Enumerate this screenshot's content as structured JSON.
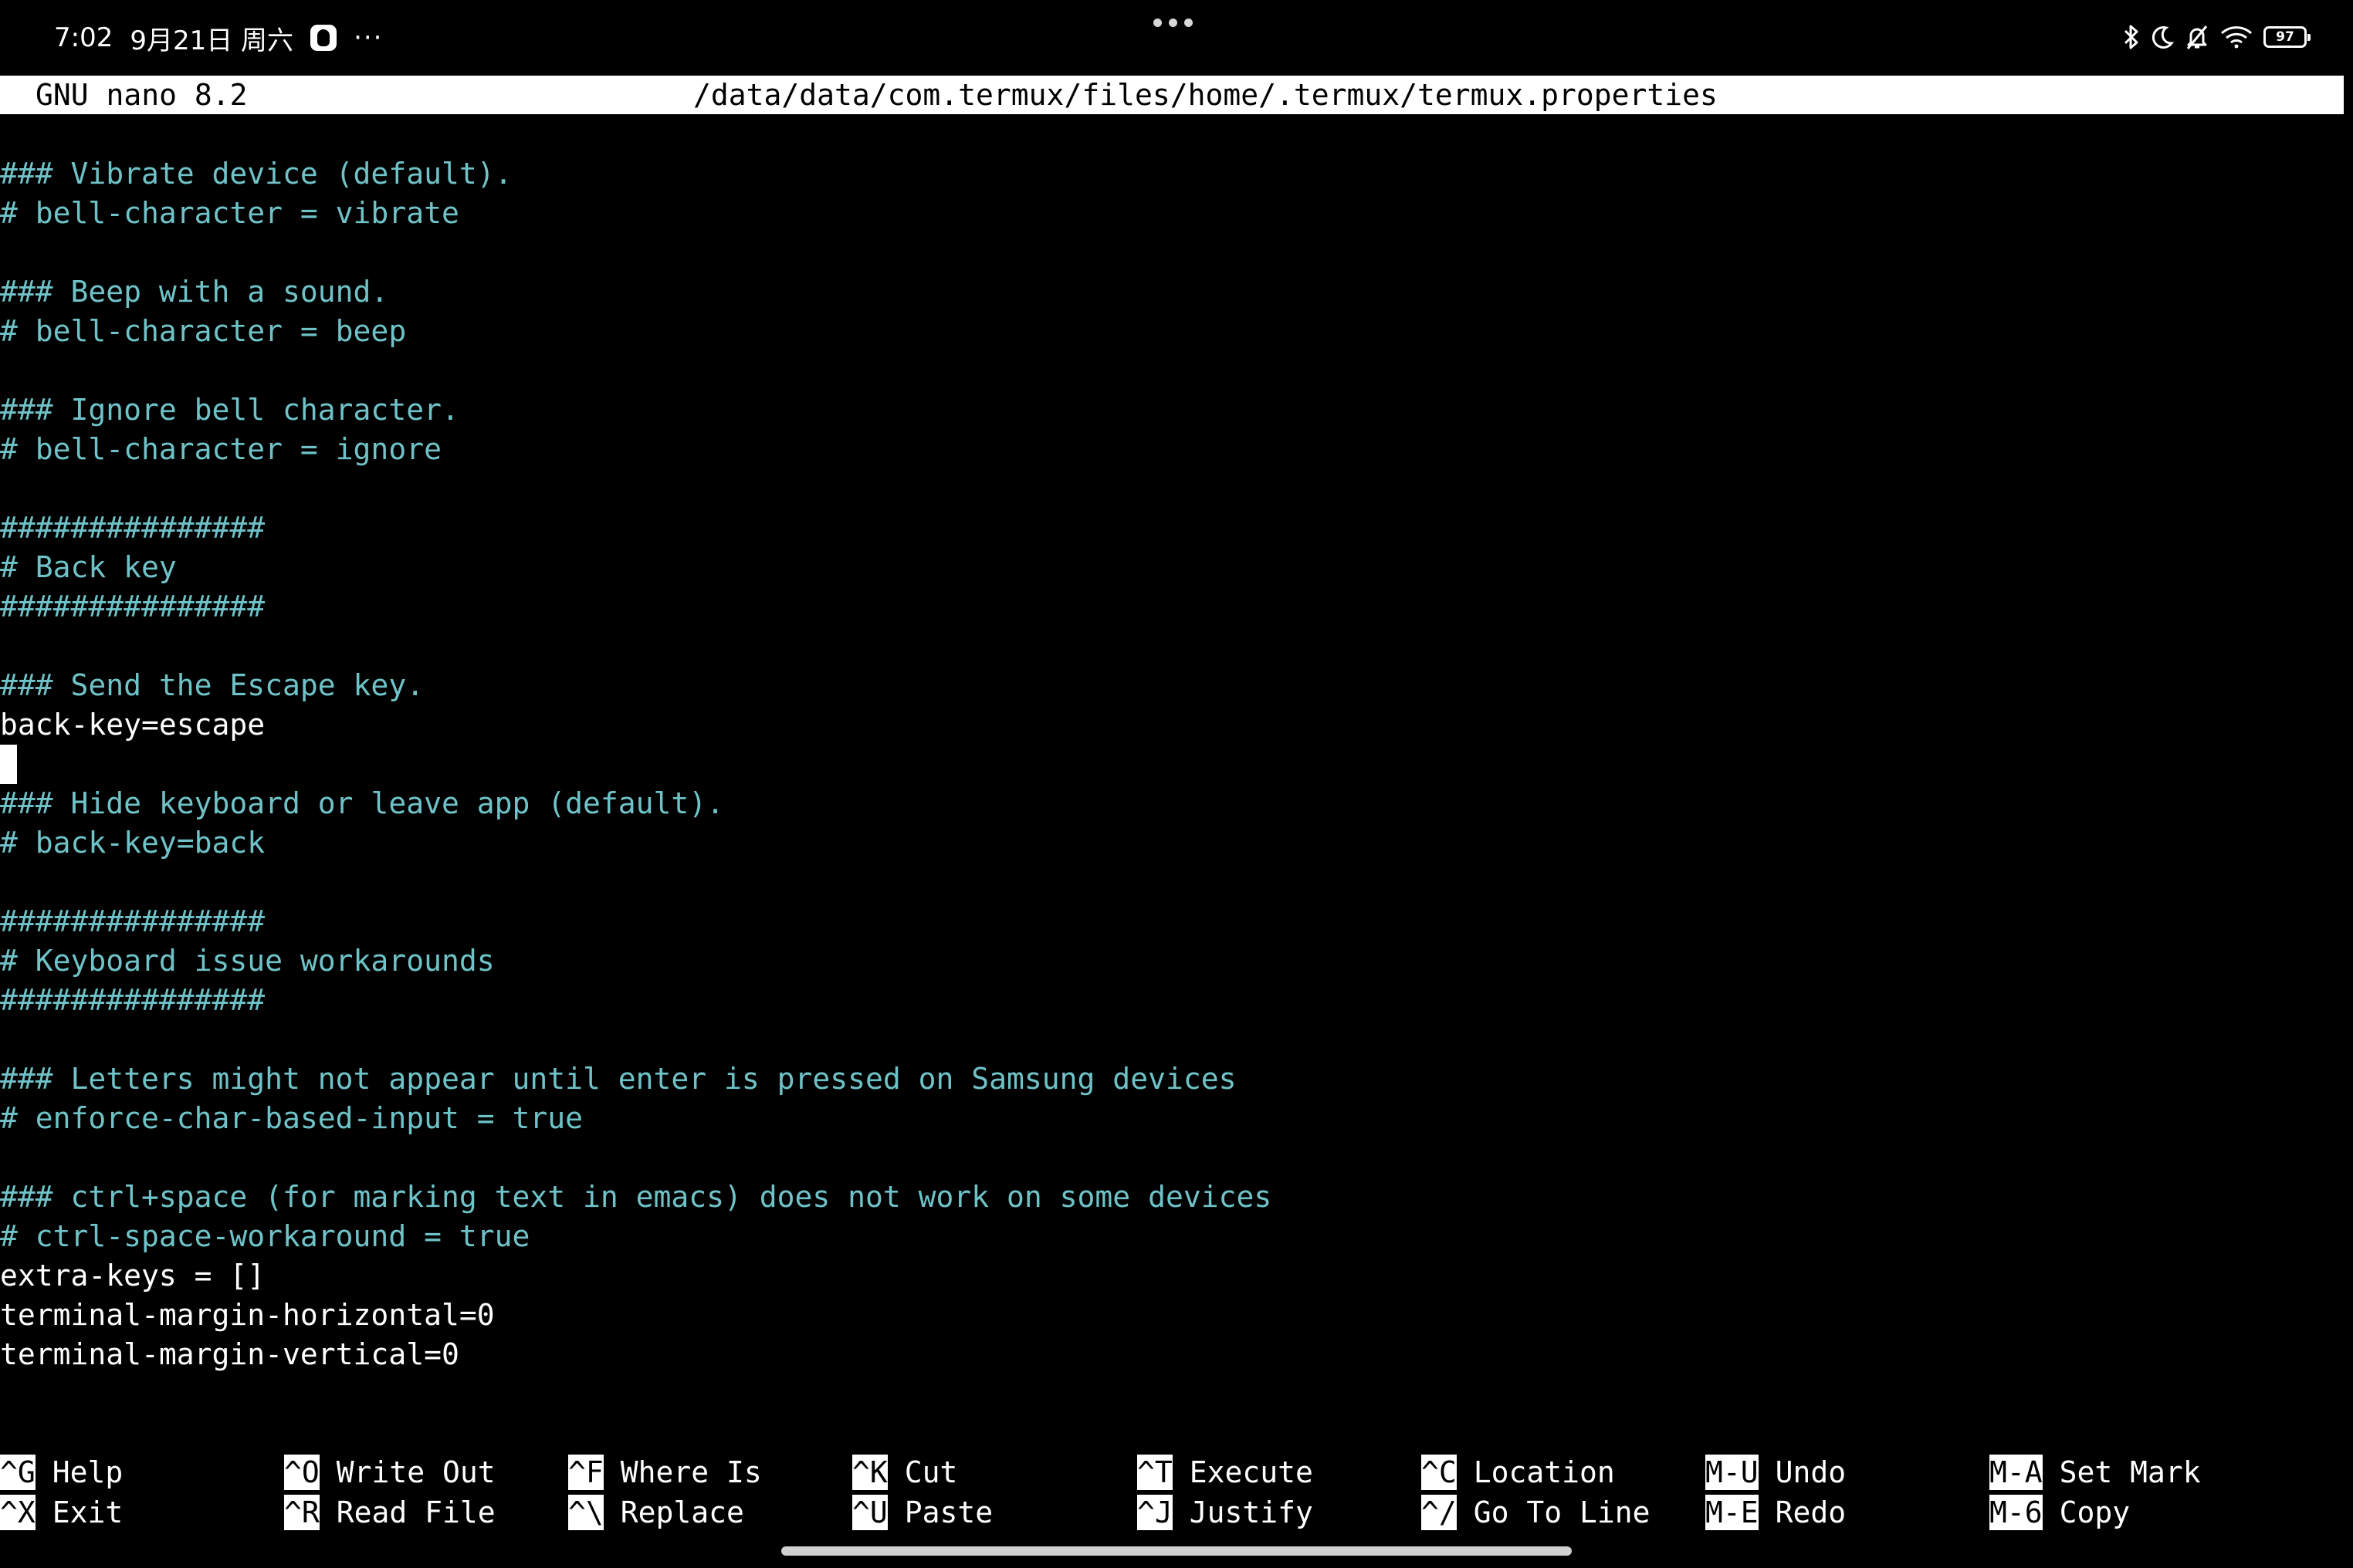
{
  "status_bar": {
    "time": "7:02",
    "date": "9月21日 周六",
    "more": "···",
    "battery": "97"
  },
  "nano": {
    "version": "GNU nano 8.2",
    "file_path": "/data/data/com.termux/files/home/.termux/termux.properties"
  },
  "editor": {
    "lines": [
      {
        "text": "### Vibrate device (default).",
        "type": "comment"
      },
      {
        "text": "# bell-character = vibrate",
        "type": "comment"
      },
      {
        "text": "",
        "type": "plain"
      },
      {
        "text": "### Beep with a sound.",
        "type": "comment"
      },
      {
        "text": "# bell-character = beep",
        "type": "comment"
      },
      {
        "text": "",
        "type": "plain"
      },
      {
        "text": "### Ignore bell character.",
        "type": "comment"
      },
      {
        "text": "# bell-character = ignore",
        "type": "comment"
      },
      {
        "text": "",
        "type": "plain"
      },
      {
        "text": "###############",
        "type": "comment"
      },
      {
        "text": "# Back key",
        "type": "comment"
      },
      {
        "text": "###############",
        "type": "comment"
      },
      {
        "text": "",
        "type": "plain"
      },
      {
        "text": "### Send the Escape key.",
        "type": "comment"
      },
      {
        "text": "back-key=escape",
        "type": "plain"
      },
      {
        "text": "",
        "type": "cursor"
      },
      {
        "text": "### Hide keyboard or leave app (default).",
        "type": "comment"
      },
      {
        "text": "# back-key=back",
        "type": "comment"
      },
      {
        "text": "",
        "type": "plain"
      },
      {
        "text": "###############",
        "type": "comment"
      },
      {
        "text": "# Keyboard issue workarounds",
        "type": "comment"
      },
      {
        "text": "###############",
        "type": "comment"
      },
      {
        "text": "",
        "type": "plain"
      },
      {
        "text": "### Letters might not appear until enter is pressed on Samsung devices",
        "type": "comment"
      },
      {
        "text": "# enforce-char-based-input = true",
        "type": "comment"
      },
      {
        "text": "",
        "type": "plain"
      },
      {
        "text": "### ctrl+space (for marking text in emacs) does not work on some devices",
        "type": "comment"
      },
      {
        "text": "# ctrl-space-workaround = true",
        "type": "comment"
      },
      {
        "text": "extra-keys = []",
        "type": "plain"
      },
      {
        "text": "terminal-margin-horizontal=0",
        "type": "plain"
      },
      {
        "text": "terminal-margin-vertical=0",
        "type": "plain"
      }
    ]
  },
  "shortcuts": [
    [
      {
        "key": "^G",
        "label": "Help"
      },
      {
        "key": "^X",
        "label": "Exit"
      }
    ],
    [
      {
        "key": "^O",
        "label": "Write Out"
      },
      {
        "key": "^R",
        "label": "Read File"
      }
    ],
    [
      {
        "key": "^F",
        "label": "Where Is"
      },
      {
        "key": "^\\",
        "label": "Replace"
      }
    ],
    [
      {
        "key": "^K",
        "label": "Cut"
      },
      {
        "key": "^U",
        "label": "Paste"
      }
    ],
    [
      {
        "key": "^T",
        "label": "Execute"
      },
      {
        "key": "^J",
        "label": "Justify"
      }
    ],
    [
      {
        "key": "^C",
        "label": "Location"
      },
      {
        "key": "^/",
        "label": "Go To Line"
      }
    ],
    [
      {
        "key": "M-U",
        "label": "Undo"
      },
      {
        "key": "M-E",
        "label": "Redo"
      }
    ],
    [
      {
        "key": "M-A",
        "label": "Set Mark"
      },
      {
        "key": "M-6",
        "label": "Copy"
      }
    ]
  ],
  "colors": {
    "comment": "#6fc3c8",
    "plain": "#ffffff",
    "background": "#000000",
    "titlebar_bg": "#ffffff"
  },
  "icons": [
    "qq-icon",
    "bluetooth-icon",
    "moon-icon",
    "bell-off-icon",
    "wifi-icon",
    "battery-icon"
  ]
}
